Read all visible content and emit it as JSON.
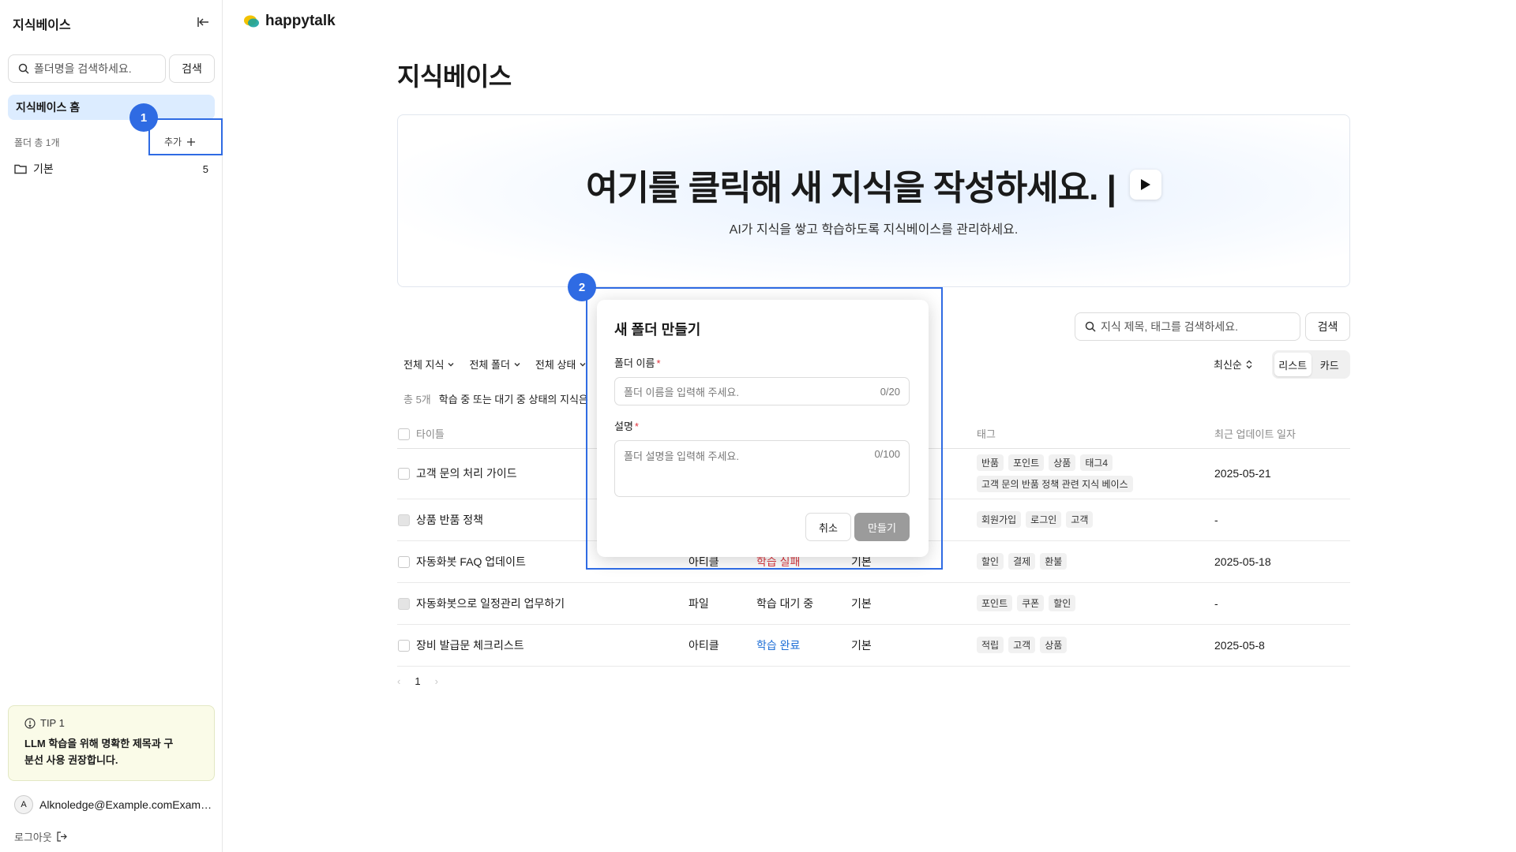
{
  "sidebar": {
    "title": "지식베이스",
    "search_placeholder": "폴더명을 검색하세요.",
    "search_button": "검색",
    "home": "지식베이스 홈",
    "folder_count": "폴더 총 1개",
    "add_label": "추가",
    "folders": [
      {
        "name": "기본",
        "count": "5"
      }
    ],
    "tip": {
      "label": "TIP 1",
      "text": "LLM 학습을 위해 명확한 제목과 구분선 사용 권장합니다."
    },
    "user": {
      "initial": "A",
      "email": "Alknoledge@Example.comExample.com"
    },
    "logout": "로그아웃"
  },
  "brand": {
    "name": "happytalk"
  },
  "main": {
    "title": "지식베이스",
    "hero": {
      "title": "여기를 클릭해 새 지식을 작성하세요. |",
      "subtitle": "AI가 지식을 쌓고 학습하도록 지식베이스를 관리하세요."
    },
    "search_placeholder": "지식 제목, 태그를 검색하세요.",
    "search_button": "검색",
    "filters": [
      "전체 지식",
      "전체 폴더",
      "전체 상태"
    ],
    "sort": "최신순",
    "view_options": [
      "리스트",
      "카드"
    ],
    "total": "총 5개",
    "notice": "학습 중 또는 대기 중 상태의 지식은",
    "columns": {
      "title": "타이틀",
      "tags": "태그",
      "updated": "최근 업데이트 일자"
    },
    "rows": [
      {
        "title": "고객 문의 처리 가이드",
        "type": "",
        "status": "",
        "folder": "",
        "tags": [
          "반품",
          "포인트",
          "상품",
          "태그4",
          "고객 문의 반품 정책 관련 지식 베이스"
        ],
        "updated": "2025-05-21",
        "disabled": false
      },
      {
        "title": "상품 반품 정책",
        "type": "",
        "status": "",
        "folder": "",
        "tags": [
          "회원가입",
          "로그인",
          "고객"
        ],
        "updated": "-",
        "disabled": true
      },
      {
        "title": "자동화봇 FAQ 업데이트",
        "type": "아티클",
        "status": "학습 실패",
        "folder": "기본",
        "tags": [
          "할인",
          "결제",
          "환불"
        ],
        "updated": "2025-05-18",
        "disabled": false
      },
      {
        "title": "자동화봇으로 일정관리 업무하기",
        "type": "파일",
        "status": "학습 대기 중",
        "folder": "기본",
        "tags": [
          "포인트",
          "쿠폰",
          "할인"
        ],
        "updated": "-",
        "disabled": true
      },
      {
        "title": "장비 발급문 체크리스트",
        "type": "아티클",
        "status": "학습 완료",
        "folder": "기본",
        "tags": [
          "적립",
          "고객",
          "상품"
        ],
        "updated": "2025-05-8",
        "disabled": false
      }
    ],
    "page": "1"
  },
  "modal": {
    "title": "새 폴더 만들기",
    "name_label": "폴더 이름",
    "name_placeholder": "폴더 이름을 입력해 주세요.",
    "name_counter": "0/20",
    "desc_label": "설명",
    "desc_placeholder": "폴더 설명을 입력해 주세요.",
    "desc_counter": "0/100",
    "cancel": "취소",
    "create": "만들기"
  },
  "annotations": [
    "1",
    "2"
  ],
  "colors": {
    "accent": "#2f6be3",
    "status_done": "#1f6fd6",
    "status_fail": "#d9363e"
  }
}
